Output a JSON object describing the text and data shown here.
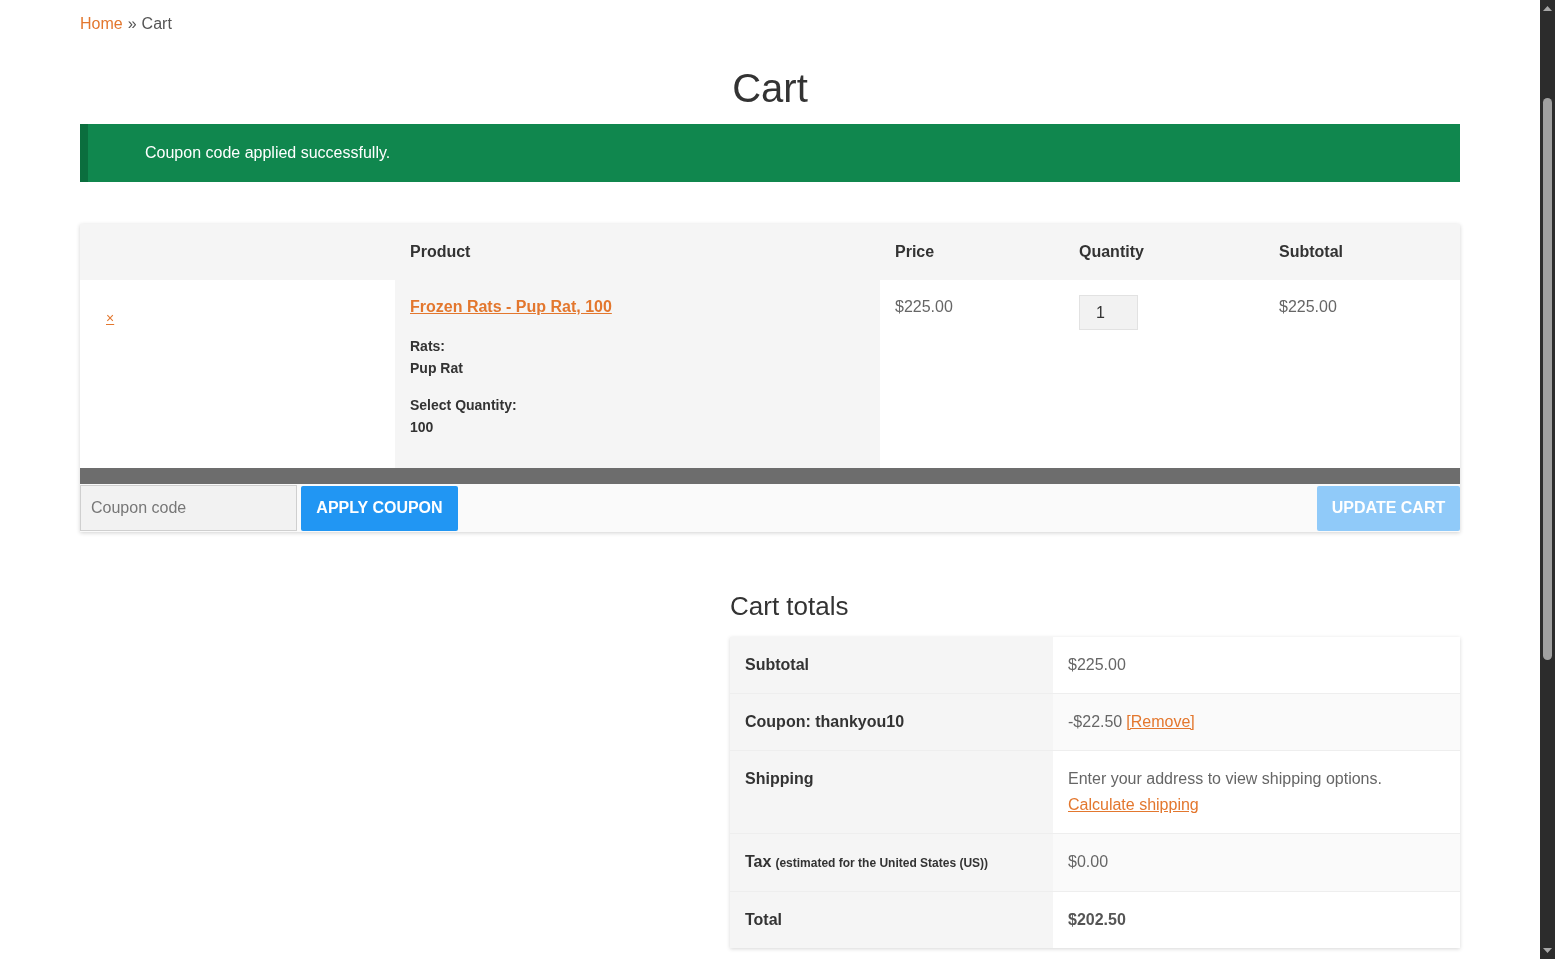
{
  "breadcrumb": {
    "items": [
      {
        "label": "Home",
        "kind": "link"
      },
      {
        "label": "Cart",
        "kind": "current"
      }
    ],
    "separator": "»"
  },
  "page_title": "Cart",
  "notice": {
    "kind": "success",
    "message": "Coupon code applied successfully."
  },
  "cart_table": {
    "columns": [
      "Product",
      "Price",
      "Quantity",
      "Subtotal"
    ],
    "rows": [
      {
        "remove": "×",
        "product": {
          "name": "Frozen Rats - Pup Rat, 100",
          "attributes": [
            {
              "label": "Rats:",
              "value": "Pup Rat"
            },
            {
              "label": "Select Quantity:",
              "value": "100"
            }
          ]
        },
        "price": "$225.00",
        "quantity": "1",
        "subtotal": "$225.00"
      }
    ],
    "actions": {
      "coupon_field": {
        "placeholder": "Coupon code"
      },
      "apply_button": {
        "label": "APPLY COUPON"
      },
      "update_button": {
        "label": "UPDATE CART",
        "disabled": true
      }
    }
  },
  "cart_totals": {
    "title": "Cart totals",
    "rows": [
      {
        "kind": "amount",
        "label": "Subtotal",
        "value": "$225.00"
      },
      {
        "kind": "coupon",
        "label": "Coupon: thankyou10",
        "value": "-$22.50",
        "link": "[Remove]"
      },
      {
        "kind": "shipping",
        "label": "Shipping",
        "value": "Enter your address to view shipping options.",
        "link": "Calculate shipping"
      },
      {
        "kind": "amount",
        "label": "Tax",
        "note": "(estimated for the United States (US))",
        "value": "$0.00"
      },
      {
        "kind": "total",
        "label": "Total",
        "value": "$202.50"
      }
    ]
  }
}
